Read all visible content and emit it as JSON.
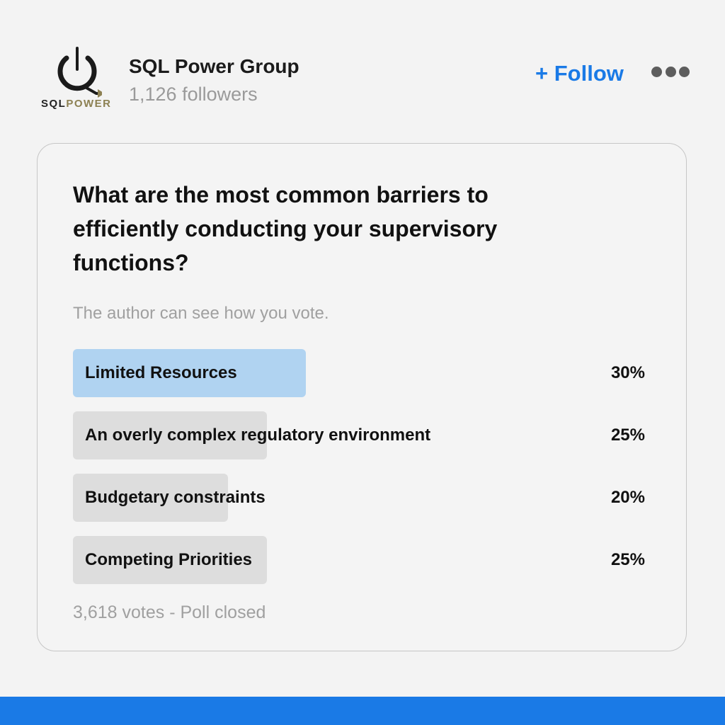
{
  "colors": {
    "accent": "#1a7ae6",
    "winning_bar": "#b0d3f1",
    "default_bar": "#dddddd",
    "logo_gold": "#8c8052"
  },
  "header": {
    "logo": {
      "word_sql": "SQL",
      "word_power": "POWER"
    },
    "company_name": "SQL Power Group",
    "followers": "1,126 followers",
    "follow_label": "+ Follow",
    "more_icon": "ellipsis-icon"
  },
  "poll": {
    "question": "What are the most common barriers to efficiently conducting your supervisory functions?",
    "privacy_note": "The author can see how you vote.",
    "options": [
      {
        "label": "Limited Resources",
        "percent_label": "30%",
        "percent": 30,
        "winner": true
      },
      {
        "label": "An overly complex regulatory environment",
        "percent_label": "25%",
        "percent": 25,
        "winner": false
      },
      {
        "label": "Budgetary constraints",
        "percent_label": "20%",
        "percent": 20,
        "winner": false
      },
      {
        "label": "Competing Priorities",
        "percent_label": "25%",
        "percent": 25,
        "winner": false
      }
    ],
    "status": "3,618 votes - Poll closed"
  }
}
